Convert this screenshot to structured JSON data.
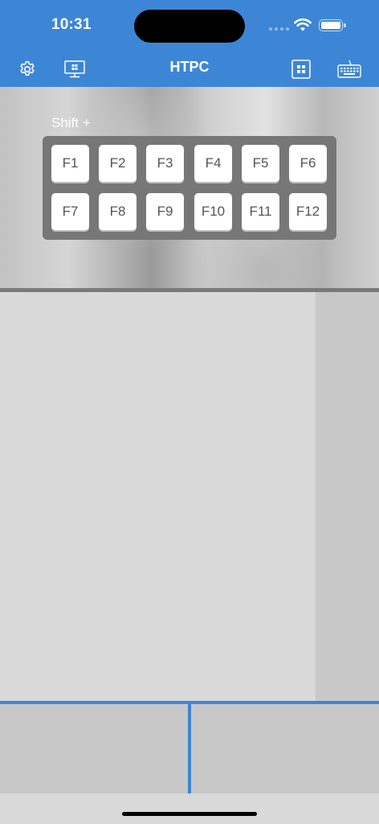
{
  "status_bar": {
    "time": "10:31"
  },
  "nav": {
    "title": "HTPC",
    "left_icons": [
      "gear-icon",
      "monitor-icon"
    ],
    "right_icons": [
      "grid-icon",
      "keyboard-icon"
    ]
  },
  "fkeys": {
    "modifier_label": "Shift +",
    "keys": [
      "F1",
      "F2",
      "F3",
      "F4",
      "F5",
      "F6",
      "F7",
      "F8",
      "F9",
      "F10",
      "F11",
      "F12"
    ]
  },
  "colors": {
    "accent": "#3d86d6",
    "touchpad": "#d9d9d9",
    "scroll_strip": "#c8c8c8",
    "key_panel": "#777777"
  }
}
